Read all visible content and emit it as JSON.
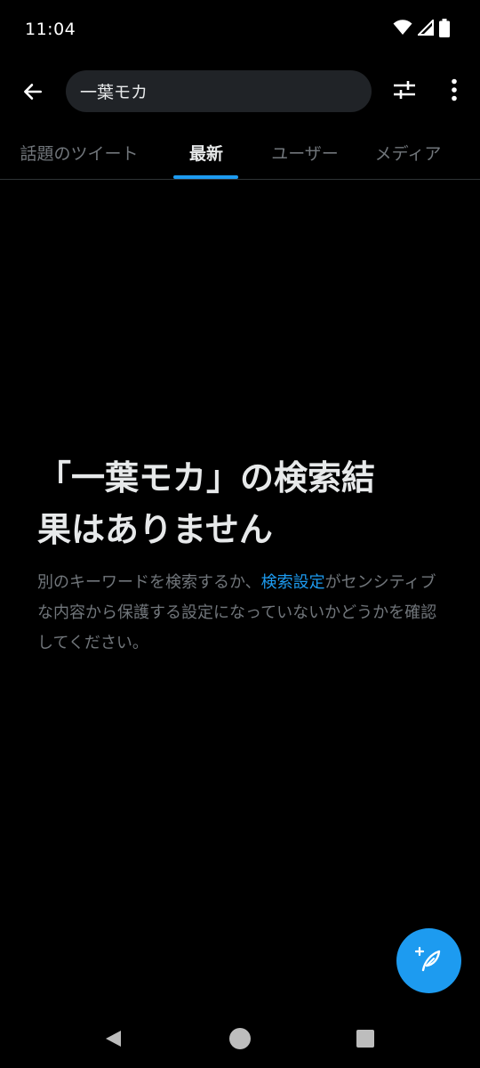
{
  "status_bar": {
    "time": "11:04",
    "icons": [
      "wifi-icon",
      "signal-icon",
      "battery-icon"
    ]
  },
  "header": {
    "back_icon": "arrow-left-icon",
    "search": {
      "value": "一葉モカ",
      "placeholder": ""
    },
    "filter_icon": "sliders-icon",
    "more_icon": "more-vertical-icon"
  },
  "tabs": [
    {
      "label": "話題のツイート",
      "active": false
    },
    {
      "label": "最新",
      "active": true
    },
    {
      "label": "ユーザー",
      "active": false
    },
    {
      "label": "メディア",
      "active": false
    }
  ],
  "empty_state": {
    "title_line1": "「一葉モカ」の検索結",
    "title_line2": "果はありません",
    "desc_before": "別のキーワードを検索するか、",
    "desc_link": "検索設定",
    "desc_after": "がセンシティブな内容から保護する設定になっていないかどうかを確認してください。"
  },
  "fab": {
    "icon": "compose-tweet-icon"
  },
  "nav": {
    "back_icon": "nav-back-icon",
    "home_icon": "nav-home-icon",
    "recents_icon": "nav-recents-icon"
  },
  "colors": {
    "background": "#000000",
    "accent": "#1d9bf0",
    "text_primary": "#e7e9ea",
    "text_secondary": "#71767b",
    "search_bg": "#202327"
  }
}
